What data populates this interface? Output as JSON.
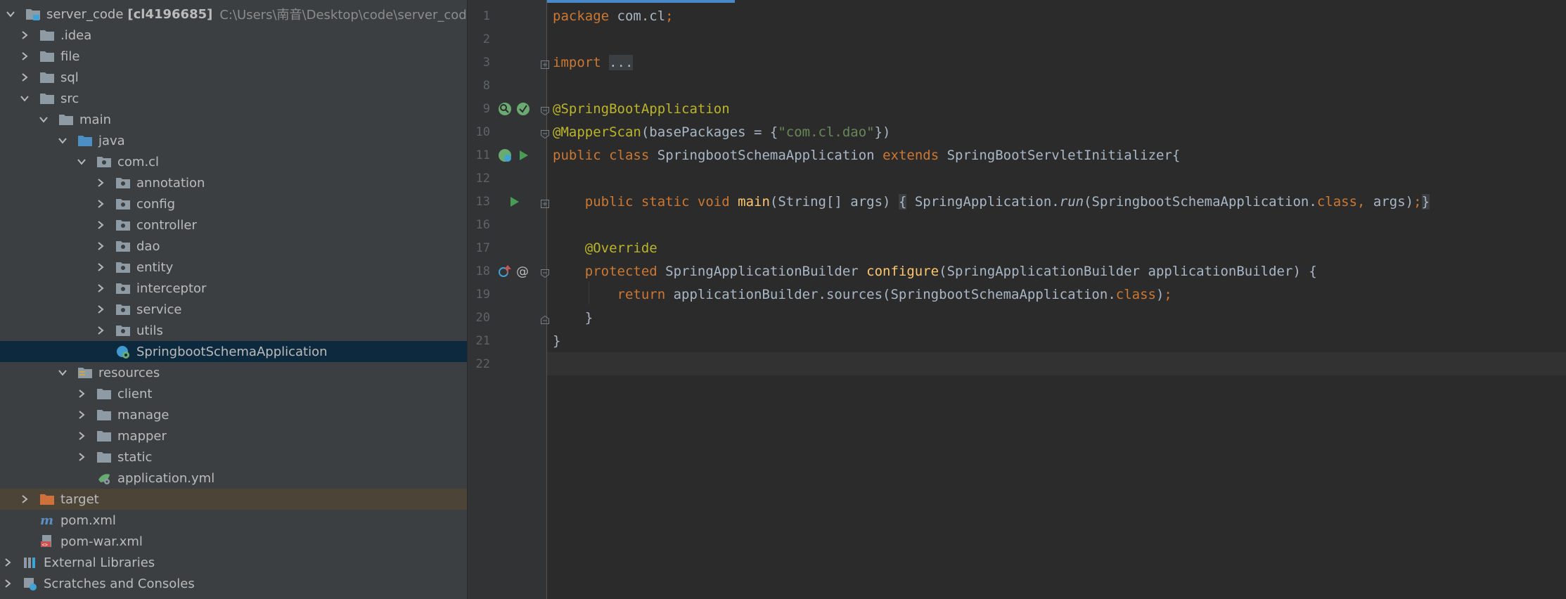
{
  "project": {
    "name": "server_code",
    "module": "[cl4196685]",
    "path": "C:\\Users\\南音\\Desktop\\code\\server_code"
  },
  "tree": {
    "idea": ".idea",
    "file": "file",
    "sql": "sql",
    "src": "src",
    "main": "main",
    "java": "java",
    "comcl": "com.cl",
    "annotation": "annotation",
    "config": "config",
    "controller": "controller",
    "dao": "dao",
    "entity": "entity",
    "interceptor": "interceptor",
    "service": "service",
    "utils": "utils",
    "app_class": "SpringbootSchemaApplication",
    "resources": "resources",
    "client": "client",
    "manage": "manage",
    "mapper": "mapper",
    "static": "static",
    "application_yml": "application.yml",
    "target": "target",
    "pom": "pom.xml",
    "pom_war": "pom-war.xml",
    "external_libraries": "External Libraries",
    "scratches": "Scratches and Consoles"
  },
  "editor": {
    "line_numbers": [
      "1",
      "2",
      "3",
      "8",
      "9",
      "10",
      "11",
      "12",
      "13",
      "16",
      "17",
      "18",
      "19",
      "20",
      "21",
      "22"
    ],
    "code": {
      "l1_kw": "package",
      "l1_rest": " com.cl",
      "l1_semi": ";",
      "l3_kw": "import",
      "l3_fold": "...",
      "l9_ann": "@SpringBootApplication",
      "l10_ann": "@MapperScan",
      "l10_a": "(basePackages = {",
      "l10_str": "\"com.cl.dao\"",
      "l10_b": "})",
      "l11_kw1": "public",
      "l11_kw2": "class",
      "l11_name": "SpringbootSchemaApplication",
      "l11_kw3": "extends",
      "l11_parent": "SpringBootServletInitializer{",
      "l13_kw": "public static void",
      "l13_fn": "main",
      "l13_args": "(String[] args)",
      "l13_open": "{",
      "l13_call_a": "SpringApplication.",
      "l13_call_run": "run",
      "l13_call_b": "(SpringbootSchemaApplication.",
      "l13_class": "class",
      "l13_comma": ",",
      "l13_call_c": " args)",
      "l13_semi": ";",
      "l13_close": "}",
      "l17_ann": "@Override",
      "l18_kw": "protected",
      "l18_type": "SpringApplicationBuilder",
      "l18_fn": "configure",
      "l18_params": "(SpringApplicationBuilder applicationBuilder) {",
      "l19_kw": "return",
      "l19_a": "applicationBuilder.sources(SpringbootSchemaApplication.",
      "l19_class": "class",
      "l19_b": ")",
      "l19_semi": ";",
      "l20": "}",
      "l21": "}"
    }
  }
}
